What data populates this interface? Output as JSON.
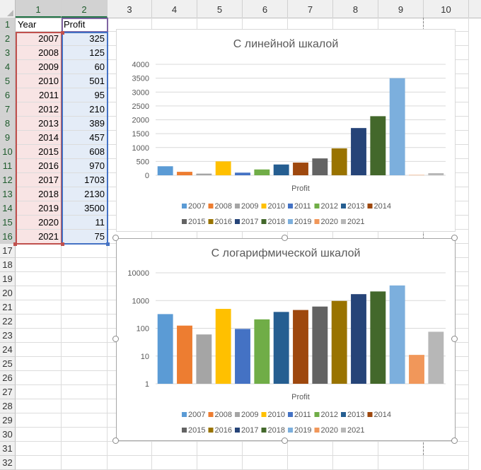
{
  "columns": [
    "1",
    "2",
    "3",
    "4",
    "5",
    "6",
    "7",
    "8",
    "9",
    "10"
  ],
  "rows": [
    "1",
    "2",
    "3",
    "4",
    "5",
    "6",
    "7",
    "8",
    "9",
    "10",
    "11",
    "12",
    "13",
    "14",
    "15",
    "16",
    "17",
    "18",
    "19",
    "20",
    "21",
    "22",
    "23",
    "24",
    "25",
    "26",
    "27",
    "28",
    "29",
    "30",
    "31",
    "32"
  ],
  "table": {
    "headers": [
      "Year",
      "Profit"
    ],
    "rows": [
      [
        "2007",
        "325"
      ],
      [
        "2008",
        "125"
      ],
      [
        "2009",
        "60"
      ],
      [
        "2010",
        "501"
      ],
      [
        "2011",
        "95"
      ],
      [
        "2012",
        "210"
      ],
      [
        "2013",
        "389"
      ],
      [
        "2014",
        "457"
      ],
      [
        "2015",
        "608"
      ],
      [
        "2016",
        "970"
      ],
      [
        "2017",
        "1703"
      ],
      [
        "2018",
        "2130"
      ],
      [
        "2019",
        "3500"
      ],
      [
        "2020",
        "11"
      ],
      [
        "2021",
        "75"
      ]
    ]
  },
  "colors": [
    "#5b9bd5",
    "#ed7d31",
    "#a5a5a5",
    "#ffc000",
    "#4472c4",
    "#70ad47",
    "#255e91",
    "#9e480e",
    "#636363",
    "#997300",
    "#264478",
    "#43682b",
    "#7cafdd",
    "#f1975a",
    "#b7b7b7"
  ],
  "chart_data": [
    {
      "type": "bar",
      "title": "С линейной шкалой",
      "xlabel": "Profit",
      "ylabel": "",
      "ylim": [
        0,
        4000
      ],
      "yscale": "linear",
      "yticks": [
        "0",
        "500",
        "1000",
        "1500",
        "2000",
        "2500",
        "3000",
        "3500",
        "4000"
      ],
      "categories": [
        "2007",
        "2008",
        "2009",
        "2010",
        "2011",
        "2012",
        "2013",
        "2014",
        "2015",
        "2016",
        "2017",
        "2018",
        "2019",
        "2020",
        "2021"
      ],
      "values": [
        325,
        125,
        60,
        501,
        95,
        210,
        389,
        457,
        608,
        970,
        1703,
        2130,
        3500,
        11,
        75
      ],
      "grid": true,
      "legend": "bottom"
    },
    {
      "type": "bar",
      "title": "С логарифмической шкалой",
      "xlabel": "Profit",
      "ylabel": "",
      "ylim": [
        1,
        10000
      ],
      "yscale": "log",
      "yticks": [
        "1",
        "10",
        "100",
        "1000",
        "10000"
      ],
      "categories": [
        "2007",
        "2008",
        "2009",
        "2010",
        "2011",
        "2012",
        "2013",
        "2014",
        "2015",
        "2016",
        "2017",
        "2018",
        "2019",
        "2020",
        "2021"
      ],
      "values": [
        325,
        125,
        60,
        501,
        95,
        210,
        389,
        457,
        608,
        970,
        1703,
        2130,
        3500,
        11,
        75
      ],
      "grid": true,
      "legend": "bottom"
    }
  ]
}
